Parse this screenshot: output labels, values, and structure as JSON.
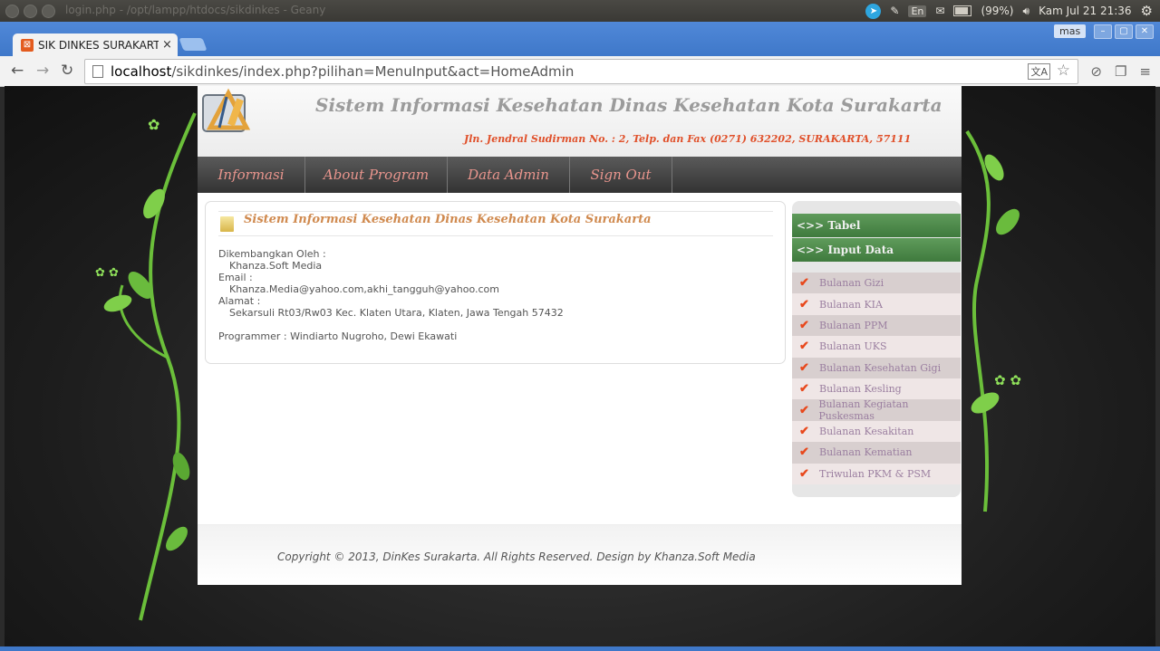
{
  "os": {
    "window_title": "login.php - /opt/lampp/htdocs/sikdinkes - Geany",
    "keyboard": "En",
    "battery": "(99%)",
    "clock": "Kam Jul 21 21:36"
  },
  "browser": {
    "tab_title": "SIK DINKES SURAKARTA",
    "tab_close": "×",
    "user": "mas",
    "url_host": "localhost",
    "url_path": "/sikdinkes/index.php?pilihan=MenuInput&act=HomeAdmin"
  },
  "site": {
    "title": "Sistem Informasi Kesehatan Dinas Kesehatan Kota Surakarta",
    "address": "Jln. Jendral Sudirman No. : 2, Telp. dan Fax (0271) 632202, SURAKARTA, 57111",
    "menu": [
      "Informasi",
      "About Program",
      "Data Admin",
      "Sign Out"
    ],
    "content_title": "Sistem Informasi Kesehatan Dinas Kesehatan Kota Surakarta",
    "info": {
      "dev_label": "Dikembangkan Oleh :",
      "dev_value": "Khanza.Soft Media",
      "email_label": "Email :",
      "email_value": "Khanza.Media@yahoo.com,akhi_tangguh@yahoo.com",
      "address_label": "Alamat :",
      "address_value": "Sekarsuli Rt03/Rw03 Kec. Klaten Utara, Klaten, Jawa Tengah 57432",
      "programmer": "Programmer : Windiarto Nugroho, Dewi Ekawati"
    },
    "sidebar": {
      "tabel": "<>> Tabel",
      "input_data": "<>> Input Data",
      "items": [
        "Bulanan Gizi",
        "Bulanan KIA",
        "Bulanan PPM",
        "Bulanan UKS",
        "Bulanan Kesehatan Gigi",
        "Bulanan Kesling",
        "Bulanan Kegiatan Puskesmas",
        "Bulanan Kesakitan",
        "Bulanan Kematian",
        "Triwulan PKM & PSM"
      ]
    },
    "footer": "Copyright © 2013, DinKes Surakarta. All Rights Reserved. Design by Khanza.Soft Media"
  }
}
